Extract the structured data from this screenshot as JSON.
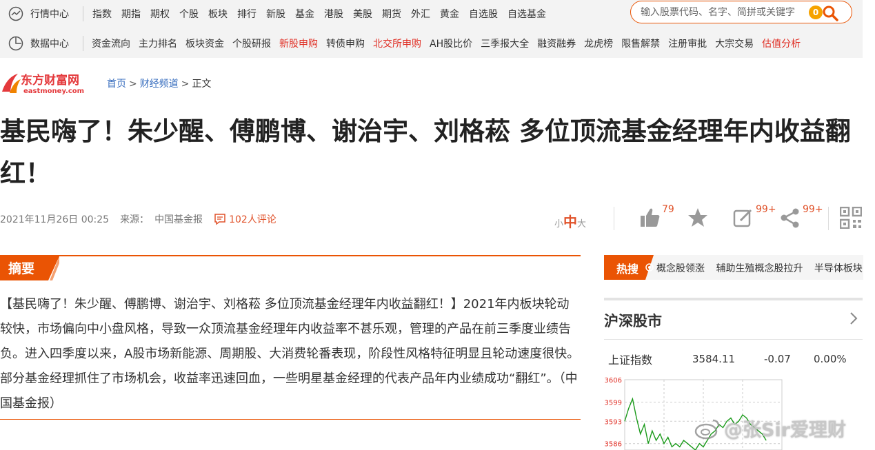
{
  "nav": {
    "row1": {
      "head": "行情中心",
      "items": [
        "指数",
        "期指",
        "期权",
        "个股",
        "板块",
        "排行",
        "新股",
        "基金",
        "港股",
        "美股",
        "期货",
        "外汇",
        "黄金",
        "自选股",
        "自选基金"
      ]
    },
    "row2": {
      "head": "数据中心",
      "items": [
        {
          "label": "资金流向",
          "red": false
        },
        {
          "label": "主力排名",
          "red": false
        },
        {
          "label": "板块资金",
          "red": false
        },
        {
          "label": "个股研报",
          "red": false
        },
        {
          "label": "新股申购",
          "red": true
        },
        {
          "label": "转债申购",
          "red": false
        },
        {
          "label": "北交所申购",
          "red": true
        },
        {
          "label": "AH股比价",
          "red": false
        },
        {
          "label": "三季报大全",
          "red": false
        },
        {
          "label": "融资融券",
          "red": false
        },
        {
          "label": "龙虎榜",
          "red": false
        },
        {
          "label": "限售解禁",
          "red": false
        },
        {
          "label": "注册审批",
          "red": false
        },
        {
          "label": "大宗交易",
          "red": false
        },
        {
          "label": "估值分析",
          "red": true
        }
      ]
    }
  },
  "search": {
    "placeholder": "输入股票代码、名字、简拼或关键字",
    "badge": "0"
  },
  "brand": {
    "cn": "东方财富网",
    "en": "eastmoney.com"
  },
  "breadcrumb": {
    "home": "首页",
    "sep": ">",
    "channel": "财经频道",
    "current": "正文"
  },
  "article": {
    "title": "基民嗨了！朱少醒、傅鹏博、谢治宇、刘格菘 多位顶流基金经理年内收益翻红！",
    "date": "2021年11月26日 00:25",
    "source_label": "来源：",
    "source": "中国基金报",
    "comments": "102人评论"
  },
  "font_size": {
    "small": "小",
    "mid": "中",
    "large": "大"
  },
  "actions": {
    "likes": "79",
    "edit": "99+",
    "share": "99+"
  },
  "summary": {
    "label": "摘要",
    "text": "【基民嗨了！朱少醒、傅鹏博、谢治宇、刘格菘 多位顶流基金经理年内收益翻红！】2021年内板块轮动较快，市场偏向中小盘风格，导致一众顶流基金经理年内收益率不甚乐观，管理的产品在前三季度业绩告负。进入四季度以来，A股市场新能源、周期股、大消费轮番表现，阶段性风格特征明显且轮动速度很快。部分基金经理抓住了市场机会，收益率迅速回血，一些明星基金经理的代表产品年内业绩成功“翻红”。（中国基金报）"
  },
  "hot": {
    "label": "热搜",
    "items": [
      "概念股领涨",
      "辅助生殖概念股拉升",
      "半导体板块"
    ]
  },
  "market": {
    "title": "沪深股市",
    "quote": {
      "name": "上证指数",
      "value": "3584.11",
      "change": "-0.07",
      "pct": "0.00%"
    },
    "chart_ticks": [
      "3606",
      "3599",
      "3593",
      "3586"
    ]
  },
  "chart_data": {
    "type": "line",
    "title": "",
    "xlabel": "",
    "ylabel": "",
    "ylim": [
      3584,
      3606
    ],
    "y_ticks": [
      3606,
      3599,
      3593,
      3586
    ],
    "series": [
      {
        "values": [
          3593,
          3597,
          3600,
          3594,
          3589,
          3592,
          3586,
          3590,
          3587,
          3589,
          3586,
          3588,
          3585,
          3586,
          3585,
          3587,
          3586,
          3585,
          3584,
          3586,
          3585,
          3587,
          3589,
          3590,
          3592,
          3591,
          3593,
          3594,
          3592,
          3593,
          3595,
          3594,
          3592,
          3591,
          3590,
          3589,
          3587
        ]
      }
    ],
    "grid": true
  },
  "watermark": "@张Sir爱理财",
  "colors": {
    "accent": "#ea5404",
    "red": "#e02e24",
    "link": "#3a6fbf",
    "line": "#1a9a1a"
  }
}
